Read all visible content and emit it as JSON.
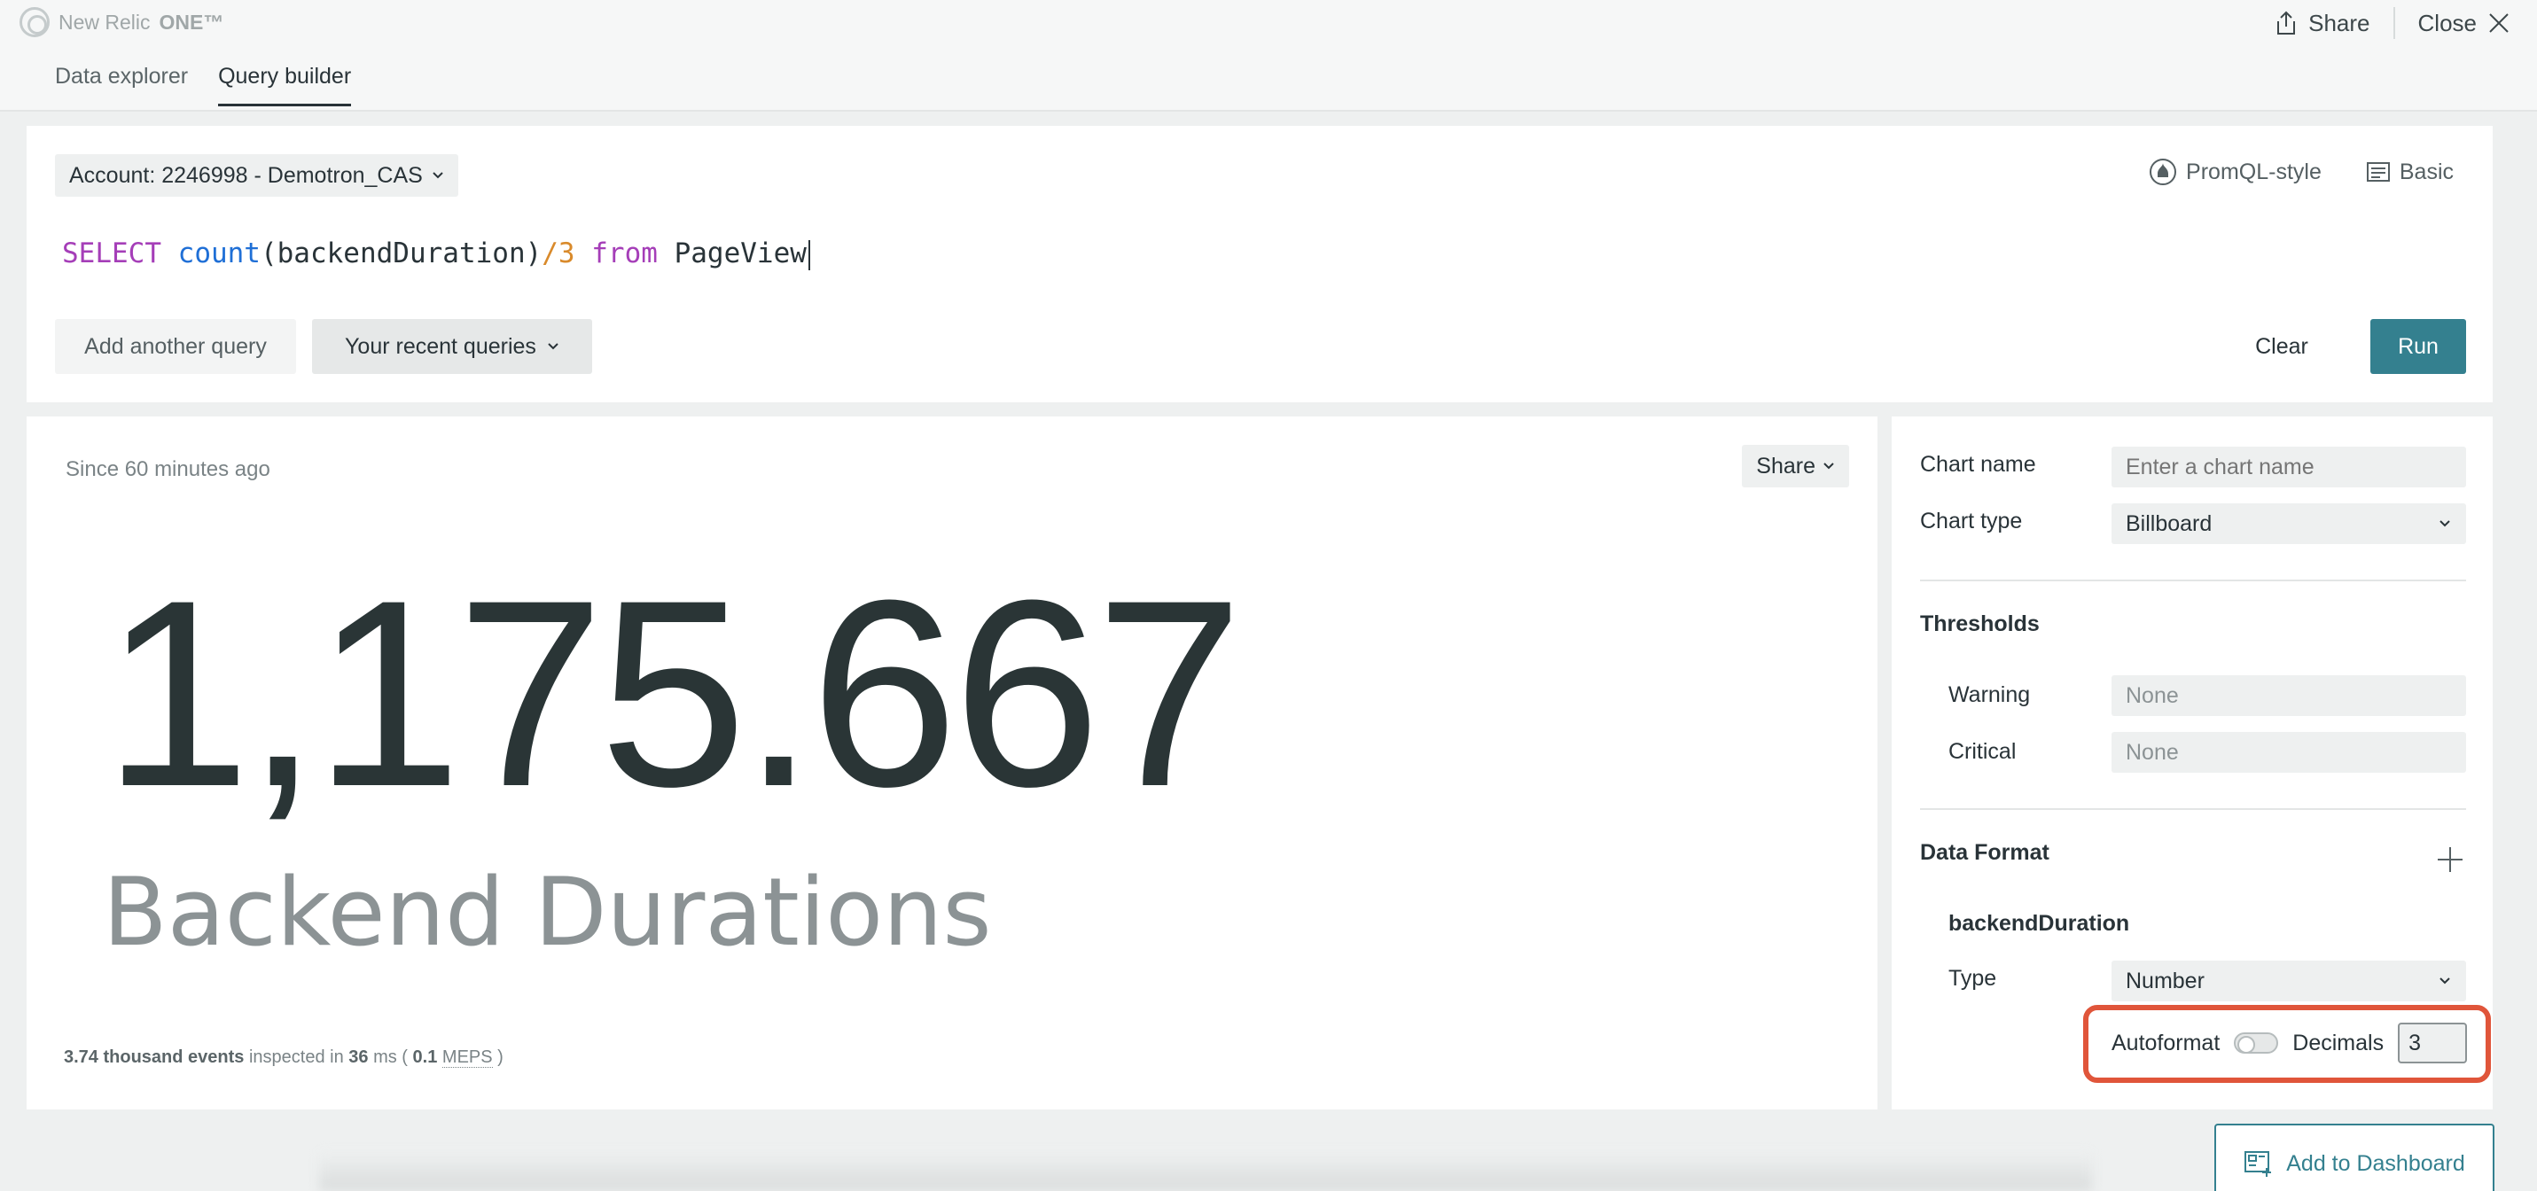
{
  "app": {
    "brand_name": "New Relic",
    "brand_suffix": "ONE™",
    "share_label": "Share",
    "close_label": "Close"
  },
  "tabs": [
    {
      "label": "Data explorer",
      "active": false
    },
    {
      "label": "Query builder",
      "active": true
    }
  ],
  "query": {
    "account_label": "Account: 2246998 - Demotron_CAS",
    "mode_promql": "PromQL-style",
    "mode_basic": "Basic",
    "nrql_select": "SELECT",
    "nrql_fn": "count",
    "nrql_arg": "(backendDuration)",
    "nrql_op": "/3",
    "nrql_from": "from",
    "nrql_event": "PageView",
    "add_query_label": "Add another query",
    "recent_label": "Your recent queries",
    "clear_label": "Clear",
    "run_label": "Run"
  },
  "result": {
    "since": "Since 60 minutes ago",
    "share_label": "Share",
    "value": "1,175.667",
    "label": "Backend Durations",
    "events_count": "3.74 thousand events",
    "inspected_text": "inspected in",
    "ms_value": "36",
    "ms_unit": "ms (",
    "meps_value": "0.1",
    "meps_unit": "MEPS",
    "close_paren": ")"
  },
  "settings": {
    "chart_name_label": "Chart name",
    "chart_name_placeholder": "Enter a chart name",
    "chart_type_label": "Chart type",
    "chart_type_value": "Billboard",
    "thresholds_title": "Thresholds",
    "warning_label": "Warning",
    "warning_value": "None",
    "critical_label": "Critical",
    "critical_value": "None",
    "data_format_title": "Data Format",
    "field_name": "backendDuration",
    "type_label": "Type",
    "type_value": "Number",
    "autoformat_label": "Autoformat",
    "autoformat_on": false,
    "decimals_label": "Decimals",
    "decimals_value": "3"
  },
  "add_dashboard_label": "Add to Dashboard",
  "colors": {
    "accent": "#34808f",
    "highlight": "#e0553a",
    "nrql_keyword": "#a53eb8",
    "nrql_function": "#1f6fd6",
    "nrql_number": "#d98a2b"
  }
}
